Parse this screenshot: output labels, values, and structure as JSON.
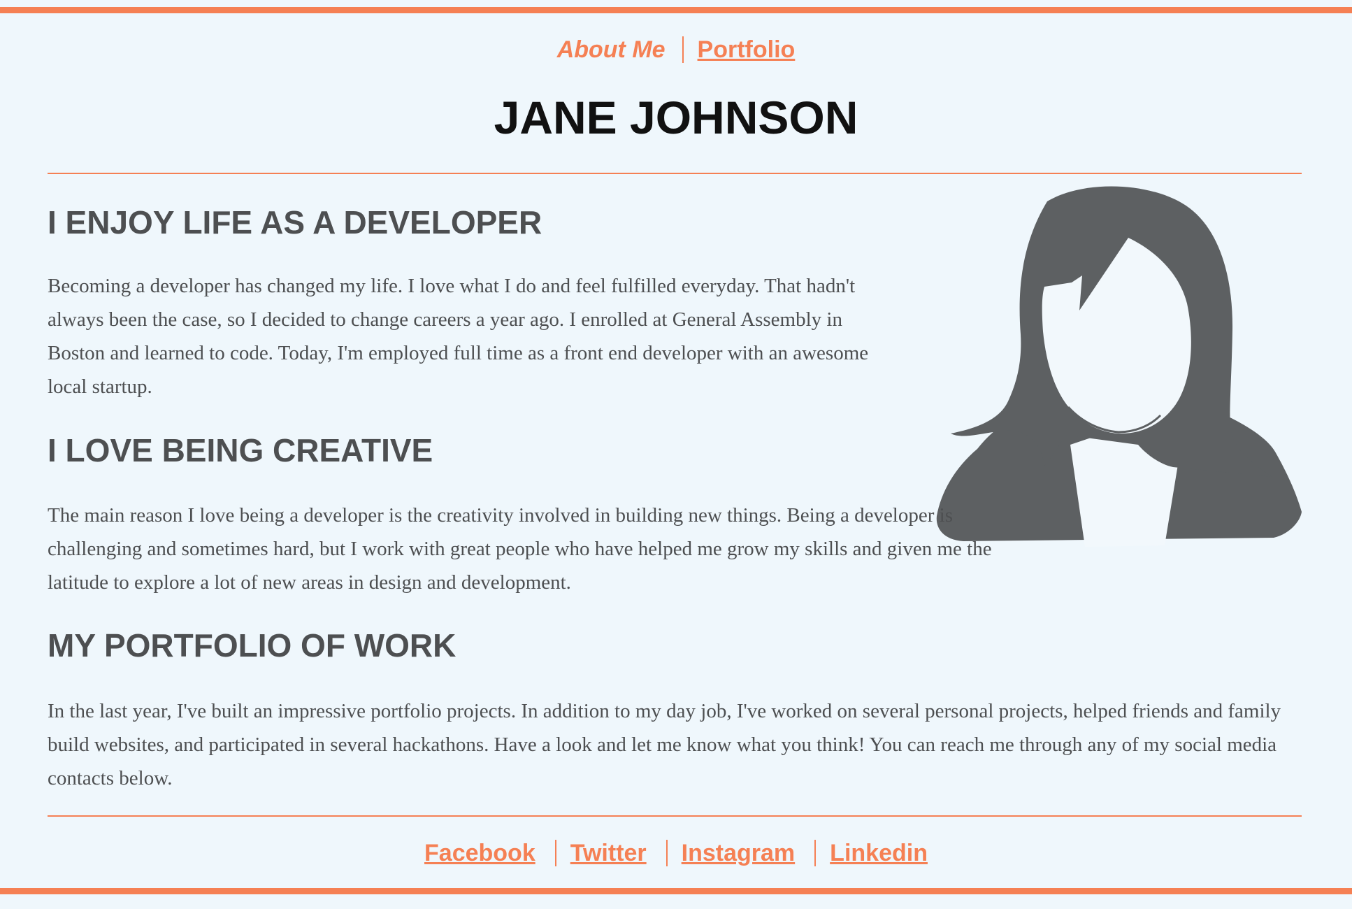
{
  "nav": {
    "items": [
      {
        "label": "About Me",
        "current": true
      },
      {
        "label": "Portfolio",
        "current": false
      }
    ]
  },
  "header": {
    "title": "JANE JOHNSON"
  },
  "avatar": {
    "icon": "woman-silhouette-icon",
    "hair_color": "#5d6062",
    "skin_color": "#f2f8fc"
  },
  "sections": [
    {
      "heading": "I ENJOY LIFE AS A DEVELOPER",
      "body": "Becoming a developer has changed my life. I love what I do and feel fulfilled everyday. That hadn't always been the case, so I decided to change careers a year ago. I enrolled at General Assembly in Boston and learned to code. Today, I'm employed full time as a front end developer with an awesome local startup."
    },
    {
      "heading": "I LOVE BEING CREATIVE",
      "body": "The main reason I love being a developer is the creativity involved in building new things. Being a developer is challenging and sometimes hard, but I work with great people who have helped me grow my skills and given me the latitude to explore a lot of new areas in design and development."
    },
    {
      "heading": "MY PORTFOLIO OF WORK",
      "body": "In the last year, I've built an impressive portfolio projects. In addition to my day job, I've worked on several personal projects, helped friends and family build websites, and participated in several hackathons. Have a look and let me know what you think! You can reach me through any of my social media contacts below."
    }
  ],
  "footer": {
    "links": [
      "Facebook",
      "Twitter",
      "Instagram",
      "Linkedin"
    ]
  },
  "colors": {
    "accent": "#f58054",
    "background": "#eff7fc",
    "heading": "#4d4f51",
    "title": "#111111"
  }
}
